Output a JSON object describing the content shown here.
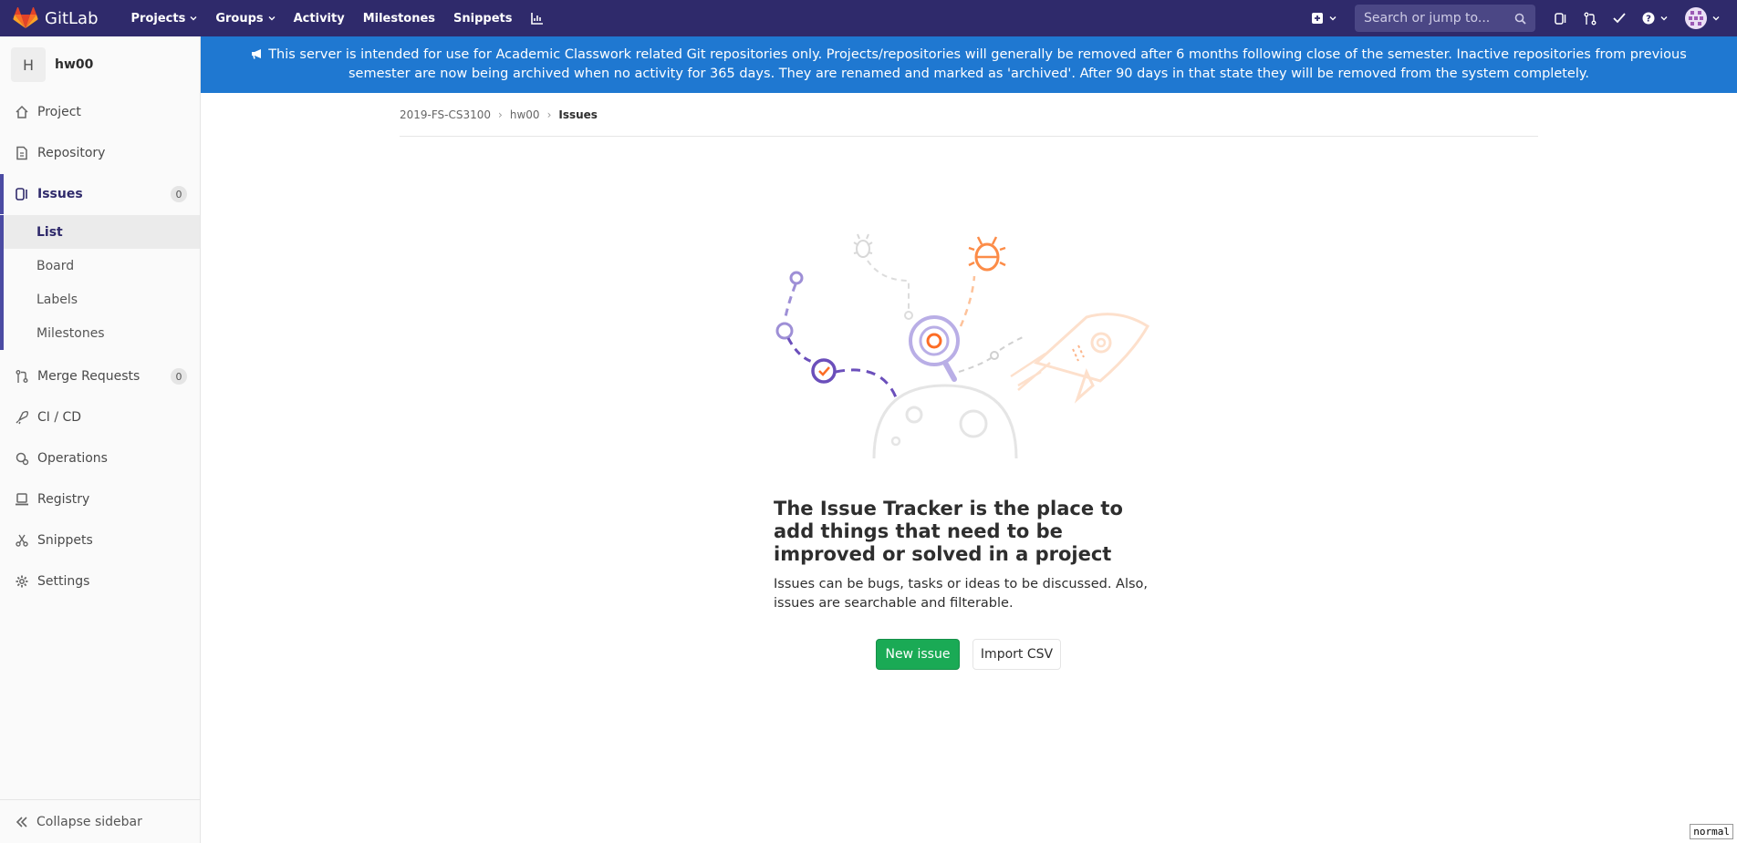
{
  "navbar": {
    "brand": "GitLab",
    "links": [
      {
        "label": "Projects",
        "dropdown": true
      },
      {
        "label": "Groups",
        "dropdown": true
      },
      {
        "label": "Activity",
        "dropdown": false
      },
      {
        "label": "Milestones",
        "dropdown": false
      },
      {
        "label": "Snippets",
        "dropdown": false
      }
    ],
    "search_placeholder": "Search or jump to..."
  },
  "sidebar": {
    "project_initial": "H",
    "project_name": "hw00",
    "items": [
      {
        "label": "Project",
        "icon": "home-icon"
      },
      {
        "label": "Repository",
        "icon": "doc-icon"
      },
      {
        "label": "Issues",
        "icon": "issues-icon",
        "count": "0",
        "active": true
      },
      {
        "label": "Merge Requests",
        "icon": "merge-request-icon",
        "count": "0"
      },
      {
        "label": "CI / CD",
        "icon": "rocket-icon"
      },
      {
        "label": "Operations",
        "icon": "cloud-gear-icon"
      },
      {
        "label": "Registry",
        "icon": "container-icon"
      },
      {
        "label": "Snippets",
        "icon": "scissors-icon"
      },
      {
        "label": "Settings",
        "icon": "gear-icon"
      }
    ],
    "issues_sub": [
      "List",
      "Board",
      "Labels",
      "Milestones"
    ],
    "collapse_label": "Collapse sidebar"
  },
  "banner": {
    "text": "This server is intended for use for Academic Classwork related Git repositories only. Projects/repositories will generally be removed after 6 months following close of the semester. Inactive repositories from previous semester are now being archived when no activity for 365 days. They are renamed and marked as 'archived'. After 90 days in that state they will be removed from the system completely."
  },
  "breadcrumb": {
    "group": "2019-FS-CS3100",
    "project": "hw00",
    "current": "Issues"
  },
  "empty_state": {
    "title": "The Issue Tracker is the place to add things that need to be improved or solved in a project",
    "description": "Issues can be bugs, tasks or ideas to be discussed. Also, issues are searchable and filterable.",
    "new_issue_label": "New issue",
    "import_csv_label": "Import CSV"
  },
  "perf_bar": "normal",
  "colors": {
    "navbar": "#2f2a6b",
    "banner": "#1f78d1",
    "primary_button": "#1aaa55",
    "active_accent": "#4b4ba3"
  }
}
